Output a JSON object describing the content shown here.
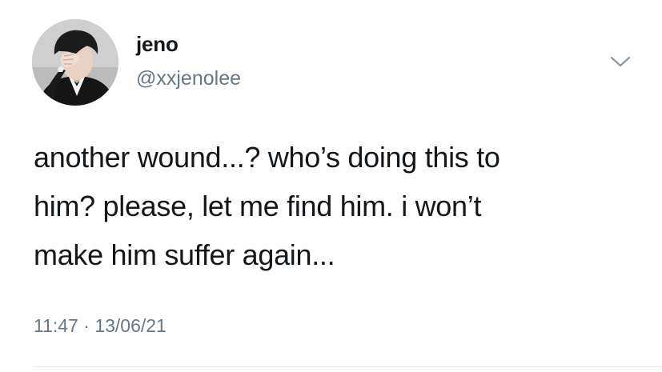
{
  "author": {
    "display_name": "jeno",
    "handle": "@xxjenolee"
  },
  "tweet": {
    "lines": [
      "another wound...? who’s doing this to",
      "him? please, let me find him. i won’t",
      "make him suffer again..."
    ],
    "time": "11:47",
    "separator": "·",
    "date": "13/06/21"
  },
  "icons": {
    "menu": "chevron-down-icon",
    "avatar": "profile-photo"
  },
  "colors": {
    "text": "#14171a",
    "secondary": "#657786",
    "divider": "#e1e8ed",
    "chevron": "#8899a6"
  }
}
